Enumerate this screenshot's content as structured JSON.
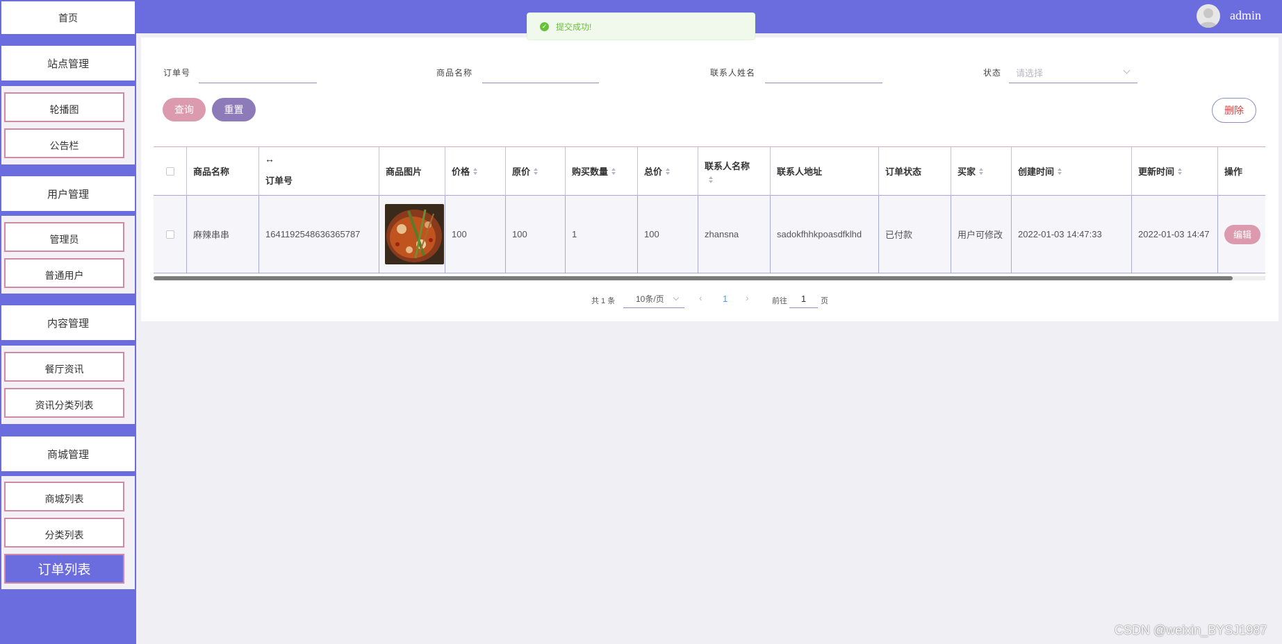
{
  "sidebar": {
    "home": "首页",
    "sections": [
      {
        "title": "站点管理",
        "items": [
          "轮播图",
          "公告栏"
        ]
      },
      {
        "title": "用户管理",
        "items": [
          "管理员",
          "普通用户"
        ]
      },
      {
        "title": "内容管理",
        "items": [
          "餐厅资讯",
          "资讯分类列表"
        ]
      },
      {
        "title": "商城管理",
        "items": [
          "商城列表",
          "分类列表",
          "订单列表"
        ]
      }
    ],
    "active_item": "订单列表"
  },
  "header": {
    "username": "admin"
  },
  "toast": {
    "message": "提交成功!",
    "icon": "check-circle-icon",
    "color": "#67c23a"
  },
  "search": {
    "order_no_label": "订单号",
    "product_name_label": "商品名称",
    "contact_name_label": "联系人姓名",
    "status_label": "状态",
    "status_placeholder": "请选择",
    "query_label": "查询",
    "reset_label": "重置",
    "delete_label": "删除"
  },
  "table": {
    "columns": [
      "商品名称",
      "订单号",
      "商品图片",
      "价格",
      "原价",
      "购买数量",
      "总价",
      "联系人名称",
      "联系人地址",
      "订单状态",
      "买家",
      "创建时间",
      "更新时间",
      "操作"
    ],
    "rows": [
      {
        "product_name": "麻辣串串",
        "order_no": "1641192548636365787",
        "image": "food-photo",
        "price": "100",
        "original_price": "100",
        "quantity": "1",
        "total": "100",
        "contact_name": "zhansna",
        "contact_address": "sadokfhhkpoasdfklhd",
        "status": "已付款",
        "buyer": "用户可修改",
        "created_at": "2022-01-03 14:47:33",
        "updated_at": "2022-01-03 14:47",
        "edit_label": "编辑"
      }
    ]
  },
  "pagination": {
    "total_text": "共 1 条",
    "page_size": "10条/页",
    "current_page": "1",
    "goto_label": "前往",
    "goto_value": "1",
    "page_suffix": "页"
  },
  "watermark": "CSDN @weixin_BYSJ1987",
  "colors": {
    "primary": "#6b6cdd",
    "pink": "#db9aad",
    "purple": "#8c7bb8",
    "danger": "#e04040"
  }
}
